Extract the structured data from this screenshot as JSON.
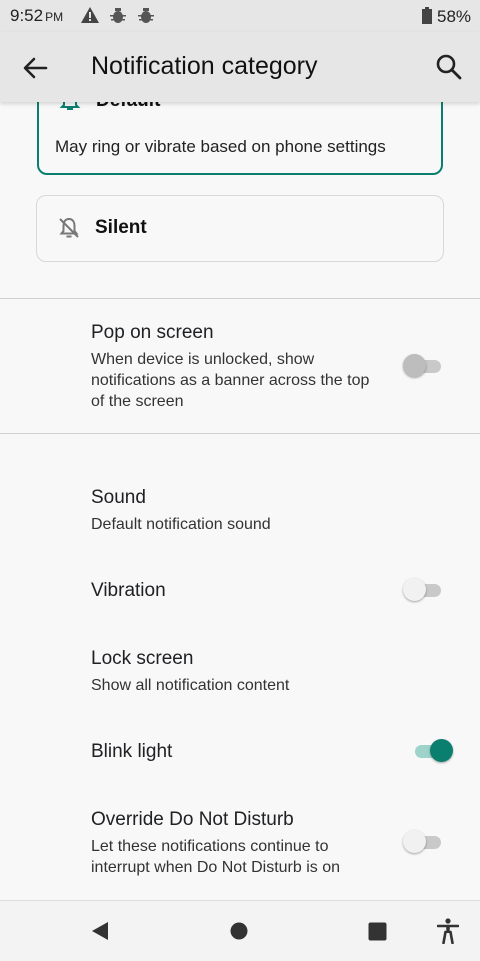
{
  "status_bar": {
    "time": "9:52",
    "ampm": "PM",
    "battery": "58%",
    "icons": [
      "warning-icon",
      "bug-icon",
      "bug-icon",
      "battery-icon"
    ]
  },
  "app_bar": {
    "title": "Notification category",
    "icons": [
      "back-arrow-icon",
      "search-icon"
    ]
  },
  "importance_cards": {
    "default": {
      "label": "Default",
      "description": "May ring or vibrate based on phone settings",
      "icon": "bell-icon",
      "selected": true
    },
    "silent": {
      "label": "Silent",
      "icon": "bell-off-icon",
      "selected": false
    }
  },
  "settings": {
    "pop_on_screen": {
      "title": "Pop on screen",
      "summary": "When device is unlocked, show notifications as a banner across the top of the screen",
      "enabled": false
    },
    "sound": {
      "title": "Sound",
      "summary": "Default notification sound"
    },
    "vibration": {
      "title": "Vibration",
      "enabled": false
    },
    "lock_screen": {
      "title": "Lock screen",
      "summary": "Show all notification content"
    },
    "blink_light": {
      "title": "Blink light",
      "enabled": true
    },
    "override_dnd": {
      "title": "Override Do Not Disturb",
      "summary": "Let these notifications continue to interrupt when Do Not Disturb is on",
      "enabled": false
    }
  },
  "nav_bar": {
    "icons": [
      "nav-back-icon",
      "home-icon",
      "recents-icon",
      "accessibility-icon"
    ]
  },
  "colors": {
    "accent": "#0b7f6f",
    "accent_track": "#9ed3cb",
    "bar_background": "#e6e6e6"
  }
}
